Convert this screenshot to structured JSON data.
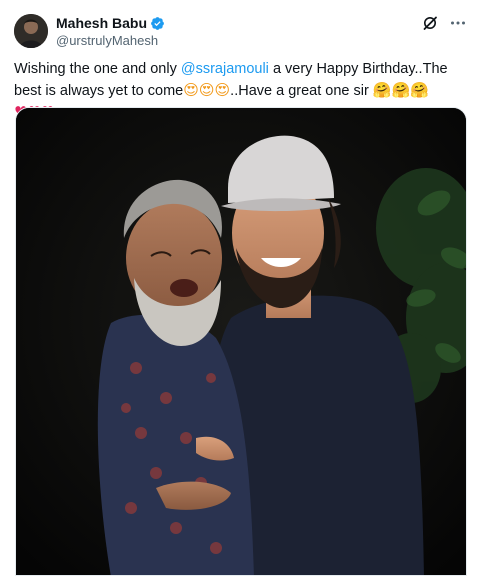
{
  "author": {
    "display_name": "Mahesh Babu",
    "handle": "@urstrulyMahesh",
    "verified": true
  },
  "icons": {
    "verified": "verified-badge-icon",
    "grok": "grok-icon",
    "more": "more-options-icon"
  },
  "tweet": {
    "text_part1": "Wishing the one and only ",
    "mention": "@ssrajamouli",
    "text_part2": " a very Happy Birthday..The best is always yet to come",
    "emoji_eyes": "😍😍😍",
    "text_part3": "..Have a great one sir ",
    "emoji_hugs": "🤗🤗🤗",
    "emoji_hearts": "♥♥♥"
  },
  "colors": {
    "accent": "#1d9bf0",
    "text": "#0f1419",
    "secondary": "#536471"
  }
}
